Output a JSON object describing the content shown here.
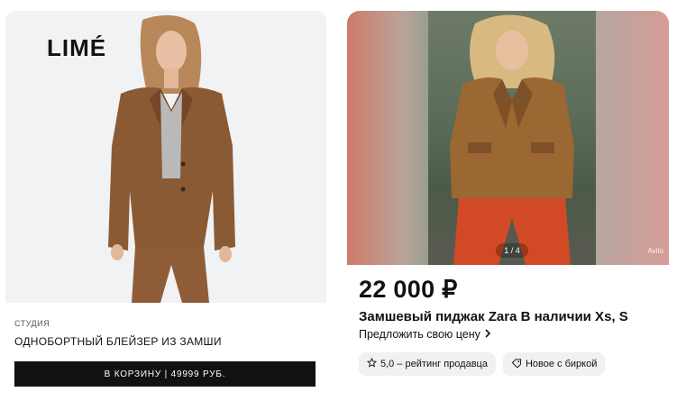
{
  "left_card": {
    "logo": "LIMÉ",
    "studio": "СТУДИЯ",
    "product_name": "ОДНОБОРТНЫЙ БЛЕЙЗЕР ИЗ ЗАМШИ",
    "cart_button": "В КОРЗИНУ | 49999 РУБ."
  },
  "right_card": {
    "image_counter": "1 / 4",
    "watermark": "Avito",
    "price": "22 000 ₽",
    "title": "Замшевый пиджак Zara В наличии Xs, S",
    "offer_link": "Предложить свою цену",
    "chips": [
      {
        "icon": "star-icon",
        "label": "5,0 – рейтинг продавца"
      },
      {
        "icon": "tag-icon",
        "label": "Новое с биркой"
      }
    ]
  },
  "colors": {
    "suede": "#8a5a34",
    "button_bg": "#111111",
    "chip_bg": "#f0f1f3",
    "trousers_right": "#d24a25"
  }
}
